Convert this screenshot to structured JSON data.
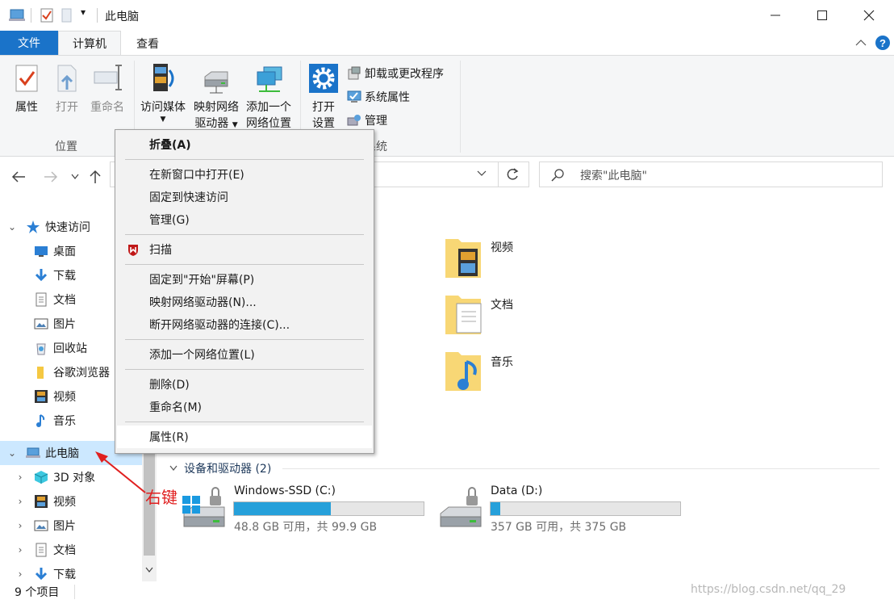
{
  "window": {
    "title": "此电脑",
    "qat_dropdown": "▾"
  },
  "tabs": {
    "file": "文件",
    "computer": "计算机",
    "view": "查看"
  },
  "ribbon": {
    "location": {
      "label": "位置",
      "properties": "属性",
      "open": "打开",
      "rename": "重命名"
    },
    "network": {
      "access_media": "访问媒体",
      "map_drive_line1": "映射网络",
      "map_drive_line2": "驱动器",
      "add_location_line1": "添加一个",
      "add_location_line2": "网络位置"
    },
    "system": {
      "label_partial": "系统",
      "open_settings_line1": "打开",
      "open_settings_line2": "设置",
      "uninstall": "卸载或更改程序",
      "system_properties": "系统属性",
      "manage": "管理"
    }
  },
  "address": {
    "search_placeholder": "搜索\"此电脑\""
  },
  "navpane": {
    "items": [
      {
        "label": "快速访问",
        "icon": "star-icon"
      },
      {
        "label": "桌面",
        "icon": "desktop-icon"
      },
      {
        "label": "下载",
        "icon": "download-icon"
      },
      {
        "label": "文档",
        "icon": "document-icon"
      },
      {
        "label": "图片",
        "icon": "pictures-icon"
      },
      {
        "label": "回收站",
        "icon": "recycle-bin-icon"
      },
      {
        "label": "谷歌浏览器",
        "icon": "folder-icon"
      },
      {
        "label": "视频",
        "icon": "video-icon"
      },
      {
        "label": "音乐",
        "icon": "music-icon"
      },
      {
        "label": "此电脑",
        "icon": "computer-icon"
      },
      {
        "label": "3D 对象",
        "icon": "3d-objects-icon"
      },
      {
        "label": "视频",
        "icon": "video-icon"
      },
      {
        "label": "图片",
        "icon": "pictures-icon"
      },
      {
        "label": "文档",
        "icon": "document-icon"
      },
      {
        "label": "下载",
        "icon": "download-icon"
      }
    ]
  },
  "folders": [
    {
      "name": "视频",
      "icon": "video-folder-icon"
    },
    {
      "name": "文档",
      "icon": "document-folder-icon"
    },
    {
      "name": "音乐",
      "icon": "music-folder-icon"
    }
  ],
  "devices": {
    "header": "设备和驱动器 (2)",
    "drives": [
      {
        "name": "Windows-SSD (C:)",
        "info": "48.8 GB 可用，共 99.9 GB",
        "used_fraction": 0.51
      },
      {
        "name": "Data (D:)",
        "info": "357 GB 可用，共 375 GB",
        "used_fraction": 0.05
      }
    ]
  },
  "context_menu": {
    "items": [
      {
        "label": "折叠(A)"
      },
      {
        "label": "在新窗口中打开(E)"
      },
      {
        "label": "固定到快速访问"
      },
      {
        "label": "管理(G)"
      },
      {
        "label": "扫描"
      },
      {
        "label": "固定到\"开始\"屏幕(P)"
      },
      {
        "label": "映射网络驱动器(N)..."
      },
      {
        "label": "断开网络驱动器的连接(C)..."
      },
      {
        "label": "添加一个网络位置(L)"
      },
      {
        "label": "删除(D)"
      },
      {
        "label": "重命名(M)"
      },
      {
        "label": "属性(R)"
      }
    ]
  },
  "status": {
    "item_count": "9 个项目"
  },
  "annotation": {
    "text": "右键"
  },
  "watermark": "https://blog.csdn.net/qq_29"
}
